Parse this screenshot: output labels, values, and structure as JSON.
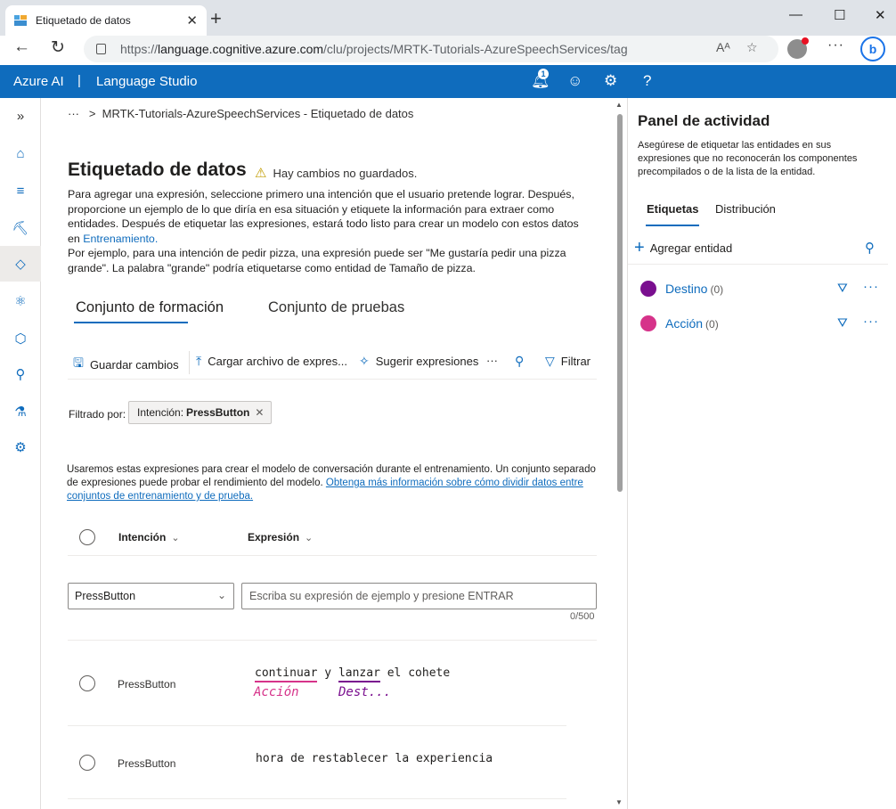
{
  "browser": {
    "tab_title": "Etiquetado de datos",
    "url_base": "https://",
    "url_host": "language.cognitive.azure.com",
    "url_path": "/clu/projects/MRTK-Tutorials-AzureSpeechServices/tag"
  },
  "header": {
    "brand": "Azure AI",
    "separator": "|",
    "product": "Language Studio",
    "notification_count": "1"
  },
  "breadcrumb": {
    "ellipsis": "···",
    "separator": ">",
    "current": "MRTK-Tutorials-AzureSpeechServices - Etiquetado de datos"
  },
  "page": {
    "title": "Etiquetado de datos",
    "warning": "Hay cambios no guardados.",
    "description_1": "Para agregar una expresión, seleccione primero una intención que el usuario pretende lograr. Después, proporcione un ejemplo de lo que diría en esa situación y etiquete la información para extraer como entidades. Después de etiquetar las expresiones, estará todo listo para crear un modelo con estos datos en ",
    "description_link": "Entrenamiento.",
    "description_2": "Por ejemplo, para una intención de pedir pizza, una expresión puede ser \"Me gustaría pedir una pizza grande\". La palabra \"grande\" podría etiquetarse como entidad de Tamaño de pizza."
  },
  "pivots": {
    "training": "Conjunto de formación",
    "testing": "Conjunto de pruebas"
  },
  "toolbar": {
    "save": "Guardar cambios",
    "upload": "Cargar archivo de expres...",
    "suggest": "Sugerir expresiones",
    "more": "···",
    "filter": "Filtrar"
  },
  "filter": {
    "label": "Filtrado por:",
    "chip_key": "Intención:",
    "chip_value": "PressButton"
  },
  "info": {
    "text": "Usaremos estas expresiones para crear el modelo de conversación durante el entrenamiento. Un conjunto separado de expresiones puede probar el rendimiento del modelo. ",
    "link": "Obtenga más información sobre cómo dividir datos entre conjuntos de entrenamiento y de prueba."
  },
  "grid": {
    "col_intent": "Intención",
    "col_expression": "Expresión"
  },
  "input": {
    "intent_selected": "PressButton",
    "placeholder": "Escriba su expresión de ejemplo y presione ENTRAR",
    "counter": "0/500"
  },
  "rows": [
    {
      "intent": "PressButton",
      "w1": "continuar",
      "w2": " y ",
      "w3": "lanzar",
      "w4": " el cohete",
      "label1": "Acción",
      "label2": "Dest..."
    },
    {
      "intent": "PressButton",
      "text": "hora de restablecer la experiencia"
    }
  ],
  "panel": {
    "title": "Panel de actividad",
    "description": "Asegúrese de etiquetar las entidades en sus expresiones que no reconocerán los componentes precompilados o de la lista de la entidad.",
    "tab_labels": "Etiquetas",
    "tab_distribution": "Distribución",
    "add_entity": "Agregar entidad",
    "entities": [
      {
        "name": "Destino",
        "count": "(0)",
        "color": "#7a0f8f"
      },
      {
        "name": "Acción",
        "count": "(0)",
        "color": "#d6338a"
      }
    ]
  },
  "colors": {
    "accent": "#0f6cbd",
    "destino": "#7a0f8f",
    "accion": "#d6338a"
  }
}
